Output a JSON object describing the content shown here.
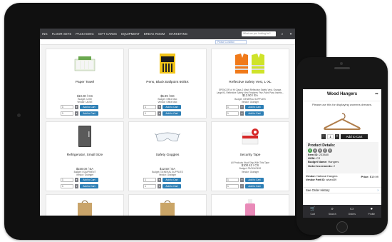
{
  "tablet": {
    "nav": {
      "items": [
        "ING",
        "FLOOR SETS",
        "PACKAGING",
        "GIFT CARDS",
        "EQUIPMENT",
        "BREAK ROOM",
        "MARKETING"
      ],
      "search_placeholder": "What are you looking for?",
      "cart_icon": "cart-icon"
    },
    "filter": {
      "value": "Please Condition"
    },
    "products": [
      {
        "title": "Paper Towel",
        "lines": [],
        "price": "$10.00 / CS",
        "meta": [
          "Budget: UOM",
          "Vendor: ULINE"
        ],
        "qty": "1",
        "add": "Add to Cart"
      },
      {
        "title": "Pens, Black Ballpoint 60/BX",
        "lines": [],
        "price": "$5.99 / BX",
        "meta": [
          "Budget: Office Max",
          "Vendor: Office Max"
        ],
        "qty": "1",
        "add": "Add to Cart"
      },
      {
        "title": "Reflective Safety Vest, L-XL",
        "lines": [
          "SPENCER of Hi Class 2 Mesh Reflective Safety Vest, Orange,",
          "Large/XL Reflective Safety Vest Features Five-Point Pass Inserts..."
        ],
        "price": "$12.50 / EA",
        "meta": [
          "Budget: GENERAL SUPPLIES",
          "Vendor: Grainger"
        ],
        "qty": "1",
        "add": "Add to Cart"
      },
      {
        "title": "Refrigerator, Small Size",
        "lines": [],
        "price": "$150.00 / EA",
        "meta": [
          "Budget: EQUIPMENT",
          "Vendor: Grainger"
        ],
        "qty": "1",
        "add": "Add to Cart"
      },
      {
        "title": "Safety Goggles",
        "lines": [],
        "price": "$12.50 / EA",
        "meta": [
          "Budget: GENERAL SUPPLIES",
          "Vendor: Grainger"
        ],
        "qty": "1",
        "add": "Add to Cart"
      },
      {
        "title": "Security Tape",
        "lines": [
          "All Products Must Ship With This Tape"
        ],
        "price": "$100.42 / CS",
        "meta": [
          "Budget: PACKAGING",
          "Vendor: Grainger"
        ],
        "qty": "1",
        "add": "Add to Cart"
      }
    ]
  },
  "phone": {
    "title": "Wood Hangers",
    "description": "Please use this for displaying womens dresses.",
    "qty": "1",
    "add_label": "Add to Cart",
    "details_heading": "Product Details:",
    "badges": [
      "$",
      "A",
      "B",
      "C",
      "D"
    ],
    "fields": [
      {
        "label": "Item ID:",
        "value": "233840"
      },
      {
        "label": "UOM:",
        "value": "CS"
      },
      {
        "label": "Budget Name:",
        "value": "Hangers"
      },
      {
        "label": "Order Increments:",
        "value": "2"
      }
    ],
    "vendor_label": "Vendor:",
    "vendor_value": "National Hangers",
    "vendor_part_label": "Vendor Part ID:",
    "vendor_part_value": "whard39",
    "price_label": "Price:",
    "price_value": "$19.99",
    "history_label": "See Order History",
    "tabs": [
      {
        "label": "Cart",
        "icon": "cart-icon",
        "glyph": "🛒"
      },
      {
        "label": "Search",
        "icon": "search-icon",
        "glyph": "⌕"
      },
      {
        "label": "Orders",
        "icon": "truck-icon",
        "glyph": "▭"
      },
      {
        "label": "Profile",
        "icon": "profile-icon",
        "glyph": "●"
      }
    ]
  },
  "colors": {
    "accent_blue": "#2d7fb5",
    "nav_dark": "#3a3b3f",
    "phone_tabbar": "#2b2b2f"
  }
}
